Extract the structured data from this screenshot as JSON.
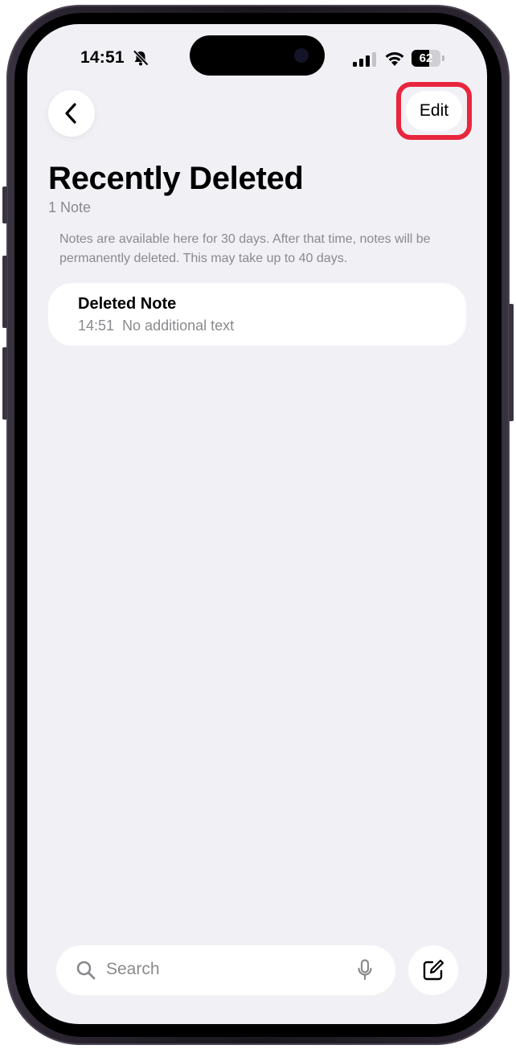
{
  "status_bar": {
    "time": "14:51",
    "battery_percent": "62",
    "battery_level": 0.62,
    "signal_bars_active": 3,
    "icons": [
      "bell-slash-icon",
      "cellular-signal-icon",
      "wifi-icon",
      "battery-icon"
    ]
  },
  "nav": {
    "back_icon": "chevron-left-icon",
    "edit_label": "Edit",
    "highlight_color": "#e8263e"
  },
  "header": {
    "title": "Recently Deleted",
    "count": "1 Note"
  },
  "info": {
    "text": "Notes are available here for 30 days. After that time, notes will be permanently deleted. This may take up to 40 days."
  },
  "notes": [
    {
      "title": "Deleted Note",
      "time": "14:51",
      "preview": "No additional text"
    }
  ],
  "bottom_bar": {
    "search_placeholder": "Search",
    "search_icon": "magnifying-glass-icon",
    "mic_icon": "microphone-icon",
    "compose_icon": "compose-icon"
  },
  "colors": {
    "background": "#f1f0f5",
    "card": "#ffffff",
    "secondary_text": "#8a8a8e",
    "accent_highlight": "#e8263e"
  }
}
